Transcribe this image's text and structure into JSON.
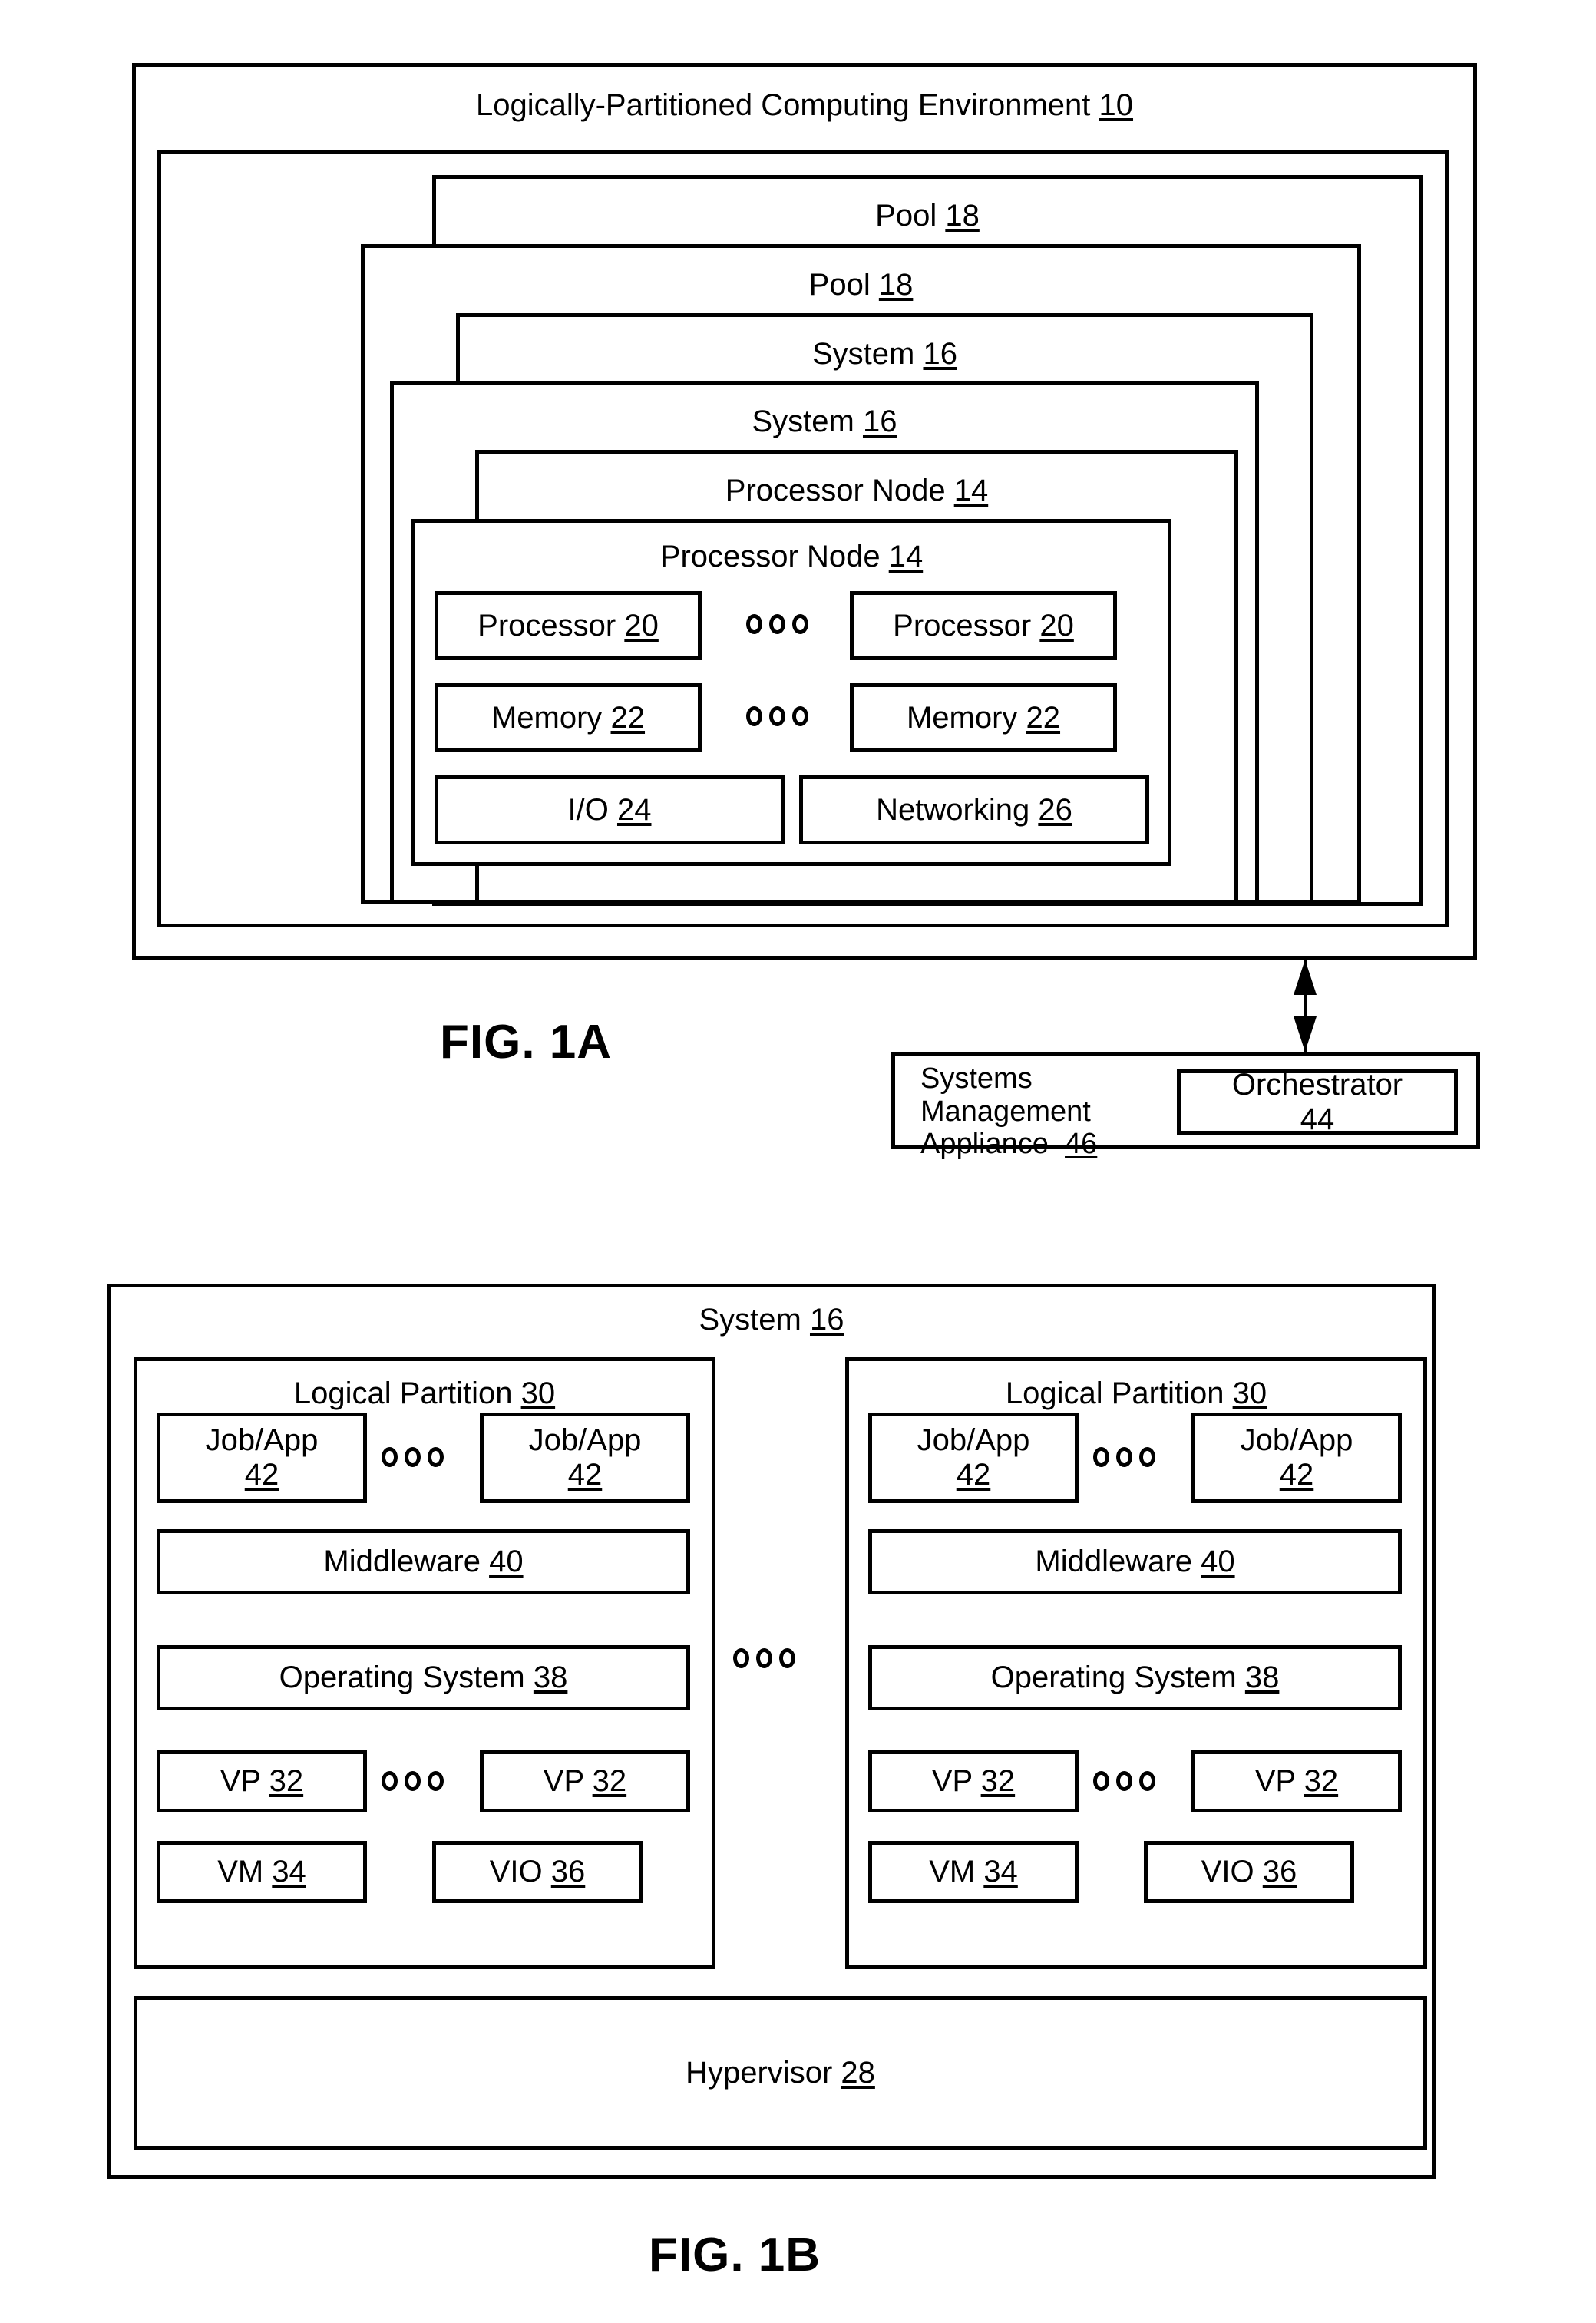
{
  "fig1a": {
    "caption": "FIG. 1A",
    "environment": {
      "label": "Logically-Partitioned Computing Environment",
      "ref": "10"
    },
    "pool_outer": {
      "label": "Pool",
      "ref": "18"
    },
    "pool_inner": {
      "label": "Pool",
      "ref": "18"
    },
    "system_outer": {
      "label": "System",
      "ref": "16"
    },
    "system_inner": {
      "label": "System",
      "ref": "16"
    },
    "node_outer": {
      "label": "Processor Node",
      "ref": "14"
    },
    "node_inner": {
      "label": "Processor Node",
      "ref": "14"
    },
    "components": {
      "processor_left": {
        "label": "Processor",
        "ref": "20"
      },
      "processor_right": {
        "label": "Processor",
        "ref": "20"
      },
      "memory_left": {
        "label": "Memory",
        "ref": "22"
      },
      "memory_right": {
        "label": "Memory",
        "ref": "22"
      },
      "io": {
        "label": "I/O",
        "ref": "24"
      },
      "networking": {
        "label": "Networking",
        "ref": "26"
      }
    },
    "appliance": {
      "label_line1": "Systems",
      "label_line2": "Management",
      "label_line3": "Appliance",
      "ref": "46",
      "orchestrator": {
        "label": "Orchestrator",
        "ref": "44"
      }
    }
  },
  "fig1b": {
    "caption": "FIG. 1B",
    "system": {
      "label": "System",
      "ref": "16"
    },
    "hypervisor": {
      "label": "Hypervisor",
      "ref": "28"
    },
    "partitions": [
      {
        "title": {
          "label": "Logical Partition",
          "ref": "30"
        },
        "job_left": {
          "label": "Job/App",
          "ref": "42"
        },
        "job_right": {
          "label": "Job/App",
          "ref": "42"
        },
        "middleware": {
          "label": "Middleware",
          "ref": "40"
        },
        "os": {
          "label": "Operating System",
          "ref": "38"
        },
        "vp_left": {
          "label": "VP",
          "ref": "32"
        },
        "vp_right": {
          "label": "VP",
          "ref": "32"
        },
        "vm": {
          "label": "VM",
          "ref": "34"
        },
        "vio": {
          "label": "VIO",
          "ref": "36"
        }
      },
      {
        "title": {
          "label": "Logical Partition",
          "ref": "30"
        },
        "job_left": {
          "label": "Job/App",
          "ref": "42"
        },
        "job_right": {
          "label": "Job/App",
          "ref": "42"
        },
        "middleware": {
          "label": "Middleware",
          "ref": "40"
        },
        "os": {
          "label": "Operating System",
          "ref": "38"
        },
        "vp_left": {
          "label": "VP",
          "ref": "32"
        },
        "vp_right": {
          "label": "VP",
          "ref": "32"
        },
        "vm": {
          "label": "VM",
          "ref": "34"
        },
        "vio": {
          "label": "VIO",
          "ref": "36"
        }
      }
    ]
  }
}
